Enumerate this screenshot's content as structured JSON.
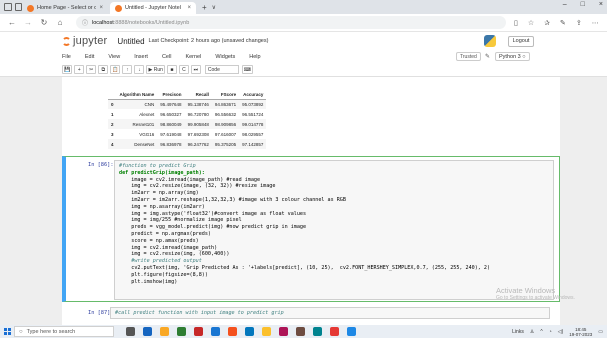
{
  "browser": {
    "tabs": [
      {
        "title": "Home Page - Select or creat",
        "close": "×",
        "favicon_color": "#f37726"
      },
      {
        "title": "Untitled - Jupyter Notel",
        "close": "×",
        "favicon_color": "#f37726"
      }
    ],
    "new_tab": "+",
    "tab_dropdown": "∨",
    "window_controls": {
      "minimize": "–",
      "maximize": "□",
      "close": "×"
    },
    "address": {
      "info": "ⓘ",
      "host": "localhost",
      "path": ":8888/notebooks/Untitled.ipynb"
    }
  },
  "jupyter": {
    "logo": "jupyter",
    "notebook_name": "Untitled",
    "checkpoint": "Last Checkpoint: 2 hours ago  (unsaved changes)",
    "logout": "Logout",
    "menu": [
      "File",
      "Edit",
      "View",
      "Insert",
      "Cell",
      "Kernel",
      "Widgets",
      "Help"
    ],
    "trusted": "Trusted",
    "kernel": "Python 3 ○",
    "toolbar": [
      "💾",
      "+",
      "✂",
      "⧉",
      "📋",
      "↑",
      "↓",
      "▶ Run",
      "■",
      "C",
      "⏭"
    ],
    "cell_type": "Code",
    "keyboard": "⌨"
  },
  "results_table": {
    "headers": [
      "",
      "Algorithm Name",
      "Precison",
      "Recall",
      "FScore",
      "Accuracy"
    ],
    "rows": [
      [
        "0",
        "CNN",
        "95.497648",
        "95.138746",
        "94.863671",
        "95.073892"
      ],
      [
        "1",
        "Alexnet",
        "96.650327",
        "96.720780",
        "96.556632",
        "96.551724"
      ],
      [
        "2",
        "Resnet101",
        "98.860049",
        "99.905848",
        "98.909856",
        "99.014778"
      ],
      [
        "3",
        "VGG16",
        "97.619048",
        "97.692308",
        "97.616007",
        "98.029557"
      ],
      [
        "4",
        "DenseNet",
        "96.836978",
        "96.247762",
        "95.375205",
        "97.142857"
      ]
    ]
  },
  "code_cell": {
    "prompt": "In [86]:",
    "lines": [
      {
        "t": "#function to predict Grip",
        "c": "cmt"
      },
      {
        "t": "def predictGrip(image_path):",
        "c": "kw"
      },
      {
        "t": "    image = cv2.imread(image_path) #read image",
        "c": ""
      },
      {
        "t": "    img = cv2.resize(image, (32, 32)) #resize image",
        "c": ""
      },
      {
        "t": "    im2arr = np.array(img)",
        "c": ""
      },
      {
        "t": "    im2arr = im2arr.reshape(1,32,32,3) #image with 3 colour channel as RGB",
        "c": ""
      },
      {
        "t": "    img = np.asarray(im2arr)",
        "c": ""
      },
      {
        "t": "    img = img.astype('float32')#convert image as float values",
        "c": ""
      },
      {
        "t": "    img = img/255 #normalize image pixel",
        "c": ""
      },
      {
        "t": "    preds = vgg_model.predict(img) #now predict grip in image",
        "c": ""
      },
      {
        "t": "    predict = np.argmax(preds)",
        "c": ""
      },
      {
        "t": "    score = np.amax(preds)",
        "c": ""
      },
      {
        "t": "    img = cv2.imread(image_path)",
        "c": ""
      },
      {
        "t": "    img = cv2.resize(img, (600,400))",
        "c": ""
      },
      {
        "t": "    #write predicted output",
        "c": "cmt"
      },
      {
        "t": "    cv2.putText(img, 'Grip Predicted As : '+labels[predict], (10, 25),  cv2.FONT_HERSHEY_SIMPLEX,0.7, (255, 255, 240), 2)",
        "c": ""
      },
      {
        "t": "    plt.figure(figsize=(8,8))",
        "c": ""
      },
      {
        "t": "    plt.imshow(img)",
        "c": ""
      }
    ]
  },
  "next_cell": {
    "prompt": "In [87]:",
    "code": "#call predict function with input image to predict grip"
  },
  "watermark": {
    "title": "Activate Windows",
    "subtitle": "Go to Settings to activate Windows."
  },
  "taskbar": {
    "search_placeholder": "Type here to search",
    "app_colors": [
      "#555555",
      "#1565c0",
      "#f9a825",
      "#2e7d32",
      "#c62828",
      "#1976d2",
      "#f4511e",
      "#0277bd",
      "#fbc02d",
      "#ad1457",
      "#6d4c41",
      "#00838f",
      "#e53935",
      "#1e88e5"
    ],
    "tray_text": "Links",
    "time": "18:45",
    "date": "19-07-2023"
  }
}
